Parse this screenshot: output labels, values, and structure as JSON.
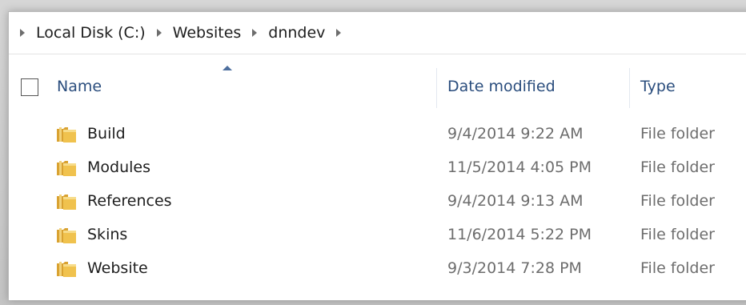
{
  "breadcrumb": {
    "items": [
      "Local Disk (C:)",
      "Websites",
      "dnndev"
    ]
  },
  "columns": {
    "name": "Name",
    "date_modified": "Date modified",
    "type": "Type"
  },
  "rows": [
    {
      "name": "Build",
      "date": "9/4/2014 9:22 AM",
      "type": "File folder"
    },
    {
      "name": "Modules",
      "date": "11/5/2014 4:05 PM",
      "type": "File folder"
    },
    {
      "name": "References",
      "date": "9/4/2014 9:13 AM",
      "type": "File folder"
    },
    {
      "name": "Skins",
      "date": "11/6/2014 5:22 PM",
      "type": "File folder"
    },
    {
      "name": "Website",
      "date": "9/3/2014 7:28 PM",
      "type": "File folder"
    }
  ],
  "icons": {
    "folder": "folder-icon",
    "breadcrumb_arrow": "chevron-right-icon",
    "sort": "sort-ascending-icon"
  },
  "colors": {
    "header_text": "#2a4d7d",
    "folder_yellow": "#e8b84a",
    "secondary_text": "#6d6d6d"
  }
}
